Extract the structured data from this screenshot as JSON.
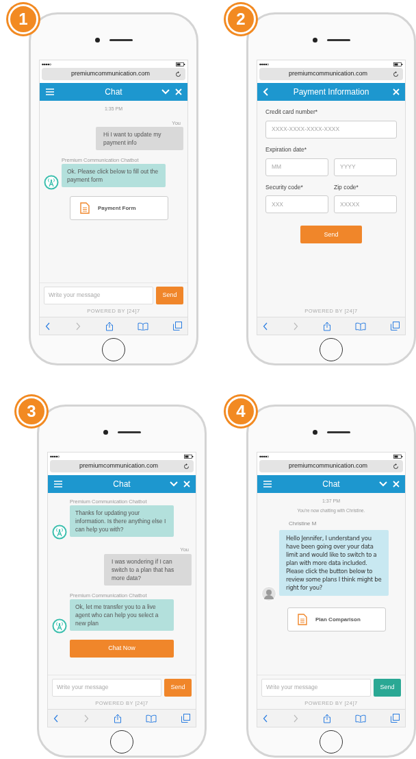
{
  "phones": [
    {
      "step": "1",
      "url": "premiumcommunication.com",
      "header": {
        "kind": "chat",
        "title": "Chat"
      },
      "body": [
        {
          "kind": "time",
          "text": "1:35 PM"
        },
        {
          "kind": "user_message",
          "sender": "You",
          "text": "Hi I want to update my payment info"
        },
        {
          "kind": "bot_message",
          "sender": "Premium Communication Chatbot",
          "text": "Ok. Please click below to fill out the payment form"
        },
        {
          "kind": "card",
          "text": "Payment Form"
        }
      ],
      "composer": {
        "placeholder": "Write your message",
        "send": "Send",
        "color": "#f0862a"
      },
      "powered_by": "POWERED BY [24]7"
    },
    {
      "step": "2",
      "url": "premiumcommunication.com",
      "header": {
        "kind": "form",
        "title": "Payment Information"
      },
      "body": [
        {
          "kind": "field_group",
          "label": "Credit card number*",
          "placeholders": [
            "XXXX-XXXX-XXXX-XXXX"
          ]
        },
        {
          "kind": "field_group",
          "label": "Expiration date*",
          "placeholders": [
            "MM",
            "YYYY"
          ]
        },
        {
          "kind": "field_pair",
          "fields": [
            {
              "label": "Security code*",
              "placeholder": "XXX"
            },
            {
              "label": "Zip code*",
              "placeholder": "XXXXX"
            }
          ]
        },
        {
          "kind": "submit",
          "text": "Send"
        }
      ],
      "powered_by": "POWERED BY [24]7"
    },
    {
      "step": "3",
      "url": "premiumcommunication.com",
      "header": {
        "kind": "chat",
        "title": "Chat"
      },
      "body": [
        {
          "kind": "bot_message",
          "sender": "Premium Communication Chatbot",
          "text": "Thanks for updating your information. Is there anything else I can help you with?"
        },
        {
          "kind": "user_message",
          "sender": "You",
          "text": "I was wondering if I can switch to a plan that has more data?"
        },
        {
          "kind": "bot_message",
          "sender": "Premium Communication Chatbot",
          "text": "Ok, let me transfer you to a live agent who can help you select a new plan"
        },
        {
          "kind": "action",
          "text": "Chat Now"
        }
      ],
      "composer": {
        "placeholder": "Write your message",
        "send": "Send",
        "color": "#f0862a"
      },
      "powered_by": "POWERED BY [24]7"
    },
    {
      "step": "4",
      "url": "premiumcommunication.com",
      "header": {
        "kind": "chat",
        "title": "Chat"
      },
      "body": [
        {
          "kind": "time",
          "text": "1:37 PM"
        },
        {
          "kind": "note",
          "text": "You're now chatting with Christine."
        },
        {
          "kind": "agent_message",
          "sender": "Christine M",
          "text": "Hello Jennifer, I understand you have been going over your data limit and would like to switch to a plan with more data included. Please click the button below to review some plans I think might be right for you?"
        },
        {
          "kind": "card",
          "text": "Plan Comparison"
        }
      ],
      "composer": {
        "placeholder": "Write your message",
        "send": "Send",
        "color": "#2aa894"
      },
      "powered_by": "POWERED BY [24]7"
    }
  ]
}
